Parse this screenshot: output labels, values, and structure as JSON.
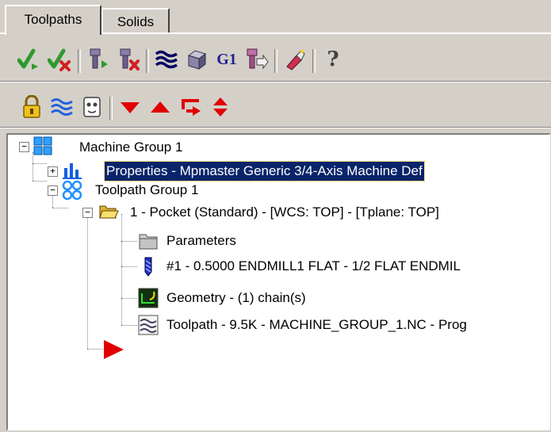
{
  "tabs": [
    {
      "label": "Toolpaths",
      "active": true
    },
    {
      "label": "Solids",
      "active": false
    }
  ],
  "toolbar1": {
    "buttons": [
      {
        "name": "select-all-operations-icon"
      },
      {
        "name": "select-dirty-operations-icon"
      },
      {
        "name": "regenerate-selected-icon"
      },
      {
        "name": "regenerate-dirty-icon"
      },
      {
        "name": "backplot-icon"
      },
      {
        "name": "verify-icon"
      },
      {
        "name": "g1-post-icon",
        "text": "G1"
      },
      {
        "name": "high-speed-toolpath-icon"
      },
      {
        "name": "delete-operations-icon"
      },
      {
        "name": "help-icon",
        "text": "?"
      }
    ]
  },
  "toolbar2": {
    "buttons": [
      {
        "name": "lock-icon"
      },
      {
        "name": "toggle-toolpath-display-icon"
      },
      {
        "name": "toggle-posting-icon"
      },
      {
        "name": "move-insert-down-icon"
      },
      {
        "name": "move-insert-up-icon"
      },
      {
        "name": "insert-after-selected-icon"
      },
      {
        "name": "scroll-insert-arrow-icon"
      }
    ]
  },
  "tree": {
    "machine_group": "Machine Group 1",
    "properties": "Properties - Mpmaster Generic 3/4-Axis Machine Def",
    "toolpath_group": "Toolpath Group 1",
    "operation": "1 - Pocket (Standard) - [WCS: TOP] - [Tplane: TOP]",
    "parameters": "Parameters",
    "tool": "#1 - 0.5000 ENDMILL1 FLAT - 1/2 FLAT ENDMIL",
    "geometry": "Geometry - (1) chain(s)",
    "toolpath": "Toolpath - 9.5K - MACHINE_GROUP_1.NC - Prog",
    "expander_collapse": "−",
    "expander_expand": "+"
  },
  "colors": {
    "selection": "#0a246a",
    "panel": "#d4d0c8",
    "check_green": "#2e9a2e",
    "check_red": "#d02020",
    "arrow_red": "#e00000"
  }
}
